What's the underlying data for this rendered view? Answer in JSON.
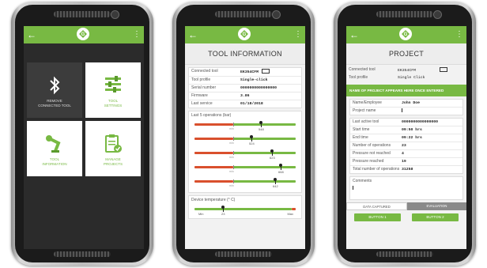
{
  "brand": {
    "accent": "#78b943",
    "alert": "#d9502d"
  },
  "appbar": {
    "back_icon": "arrow-left-icon",
    "logo_icon": "g-logo-icon",
    "menu_icon": "kebab-menu-icon"
  },
  "home": {
    "tiles": [
      {
        "label_l1": "REMOVE",
        "label_l2": "CONNECTED TOOL",
        "icon": "bluetooth-icon"
      },
      {
        "label_l1": "TOOL",
        "label_l2": "SETTINGS",
        "icon": "sliders-icon"
      },
      {
        "label_l1": "TOOL",
        "label_l2": "INFORMATION",
        "icon": "robot-arm-icon"
      },
      {
        "label_l1": "MANAGE",
        "label_l2": "PROJECTS",
        "icon": "clipboard-check-icon"
      }
    ]
  },
  "tool_info": {
    "title": "TOOL INFORMATION",
    "rows": [
      {
        "k": "Connected tool",
        "v": "EK354CFM"
      },
      {
        "k": "Tool profile",
        "v": "Single-click"
      },
      {
        "k": "Serial number",
        "v": "0000000000000000"
      },
      {
        "k": "Firmware",
        "v": "3.86"
      },
      {
        "k": "Last service",
        "v": "01/18/2018"
      }
    ],
    "ops_title": "Last 5 operations (bar)",
    "ops": [
      {
        "low": "min",
        "val": "548",
        "level": 0.62
      },
      {
        "low": "min",
        "val": "524",
        "level": 0.53
      },
      {
        "low": "min",
        "val": "623",
        "level": 0.72
      },
      {
        "low": "min",
        "val": "668",
        "level": 0.8
      },
      {
        "low": "min",
        "val": "642",
        "level": 0.75
      }
    ],
    "temp_title": "Device temperature (° C)",
    "temp": {
      "min": "Min",
      "val": "23",
      "max": "Max",
      "level": 0.28
    }
  },
  "project": {
    "title": "PROJECT",
    "connected_tool_k": "Connected tool",
    "connected_tool_v": "EK354CFM",
    "tool_profile_k": "Tool profile",
    "tool_profile_v": "Single Click",
    "banner": "NAME OF PROJECT APPEARS HERE ONCE ENTERED",
    "name_k": "Name/Employee",
    "name_v": "John Doe",
    "project_name_k": "Project name",
    "stats": [
      {
        "k": "Last active tool",
        "v": "0000000000000000"
      },
      {
        "k": "Start time",
        "v": "09:50 hrs"
      },
      {
        "k": "End time",
        "v": "09:22 hrs"
      },
      {
        "k": "Number of operations",
        "v": "23"
      },
      {
        "k": "Pressure not reached",
        "v": "4"
      },
      {
        "k": "Pressure reached",
        "v": "19"
      },
      {
        "k": "Total number of operations",
        "v": "31258"
      }
    ],
    "comments_label": "Comments",
    "tab_data": "DATA CAPTURED",
    "tab_eval": "EVALUATION",
    "button1": "BUTTON 1",
    "button2": "BUTTON 2"
  }
}
